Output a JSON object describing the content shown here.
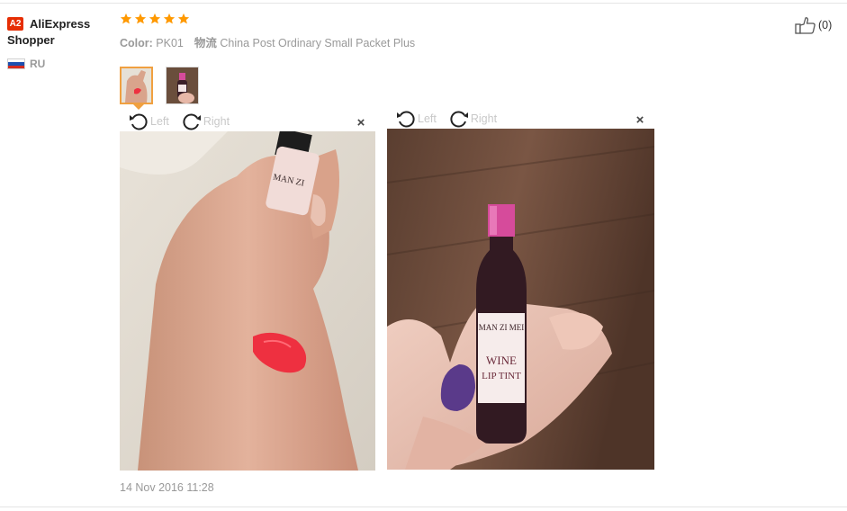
{
  "reviewer": {
    "badge": "A2",
    "name_line1": "AliExpress",
    "name_line2": "Shopper",
    "country": "RU"
  },
  "review": {
    "rating": 5,
    "color_label": "Color:",
    "color_value": "PK01",
    "shipping_label": "物流",
    "shipping_value": "China Post Ordinary Small Packet Plus",
    "date": "14 Nov 2016 11:28"
  },
  "helpful": {
    "count": "(0)"
  },
  "image_viewer": {
    "left_label": "Left",
    "right_label": "Right",
    "close_glyph": "×"
  },
  "bottle_label": {
    "line1": "MAN ZI MEI",
    "line2": "WINE",
    "line3": "LIP TINT"
  },
  "colors": {
    "star": "#ff9900",
    "badge": "#e62e04",
    "swatch": "#ee3040"
  },
  "icons": [
    "star-icon",
    "thumbs-up-icon",
    "russia-flag-icon",
    "rotate-left-icon",
    "rotate-right-icon",
    "close-icon"
  ]
}
